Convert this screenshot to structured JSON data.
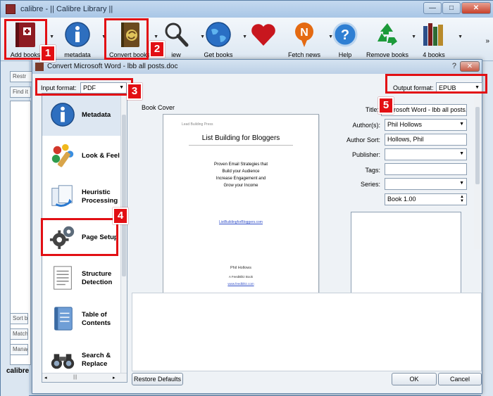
{
  "main_window": {
    "title": "calibre - || Calibre Library ||",
    "window_buttons": {
      "minimize": "—",
      "maximize": "□",
      "close": "✕"
    },
    "toolbar": [
      {
        "label": "Add books",
        "icon": "add-books-icon"
      },
      {
        "label": "metadata",
        "icon": "info-icon"
      },
      {
        "label": "Convert books",
        "icon": "convert-books-icon"
      },
      {
        "label": "iew",
        "icon": "magnifier-icon"
      },
      {
        "label": "Get books",
        "icon": "globe-icon"
      },
      {
        "label": "",
        "icon": "heart-icon"
      },
      {
        "label": "Fetch news",
        "icon": "fetch-news-icon"
      },
      {
        "label": "Help",
        "icon": "help-icon"
      },
      {
        "label": "Remove books",
        "icon": "recycle-icon"
      },
      {
        "label": "4 books",
        "icon": "library-books-icon"
      }
    ],
    "overflow": "»",
    "left_stubs": [
      "Restr",
      "Find it",
      "Sort b",
      "Match",
      "Manag"
    ],
    "footer": "calibre"
  },
  "dialog": {
    "title": "Convert Microsoft Word - lbb all posts.doc",
    "help_glyph": "?",
    "close_glyph": "✕",
    "input_format_label": "Input format:",
    "input_format_value": "PDF",
    "output_format_label": "Output format:",
    "output_format_value": "EPUB",
    "nav": [
      {
        "label": "Metadata",
        "icon": "metadata-info-icon",
        "selected": true
      },
      {
        "label": "Look & Feel",
        "icon": "look-feel-icon",
        "selected": false
      },
      {
        "label": "Heuristic Processing",
        "icon": "heuristic-icon",
        "selected": false
      },
      {
        "label": "Page Setup",
        "icon": "page-setup-gear-icon",
        "selected": false
      },
      {
        "label": "Structure Detection",
        "icon": "structure-doc-icon",
        "selected": false
      },
      {
        "label": "Table of Contents",
        "icon": "toc-book-icon",
        "selected": false
      },
      {
        "label": "Search & Replace",
        "icon": "binoculars-icon",
        "selected": false
      }
    ],
    "nav_hscroll_arrows": {
      "left": "◂",
      "right": "▸",
      "thumb": "|||"
    },
    "book_cover_label": "Book Cover",
    "cover": {
      "header_text": "Lead Building Press",
      "title": "List Building for Bloggers",
      "subtitle_lines": [
        "Proven Email Strategies that",
        "Build your Audience",
        "Increase Engagement and",
        "Grow your Income"
      ],
      "link": "ListBuildingforBloggers.com",
      "author_lines": [
        "Phil Hollows",
        "A FeedBlitz Book",
        "www.feedblitz.com"
      ]
    },
    "metadata": {
      "title_label": "Title:",
      "title_value": "Microsoft Word - lbb all posts.doc",
      "authors_label": "Author(s):",
      "authors_value": "Phil Hollows",
      "author_sort_label": "Author Sort:",
      "author_sort_value": "Hollows, Phil",
      "publisher_label": "Publisher:",
      "publisher_value": "",
      "tags_label": "Tags:",
      "tags_value": "",
      "series_label": "Series:",
      "series_value": "",
      "series_index_value": "Book 1.00"
    },
    "buttons": {
      "restore_defaults": "Restore Defaults",
      "ok": "OK",
      "cancel": "Cancel"
    }
  },
  "annotations": [
    {
      "number": "1",
      "target": "Add books"
    },
    {
      "number": "2",
      "target": "Convert books"
    },
    {
      "number": "3",
      "target": "Input format"
    },
    {
      "number": "4",
      "target": "Page Setup"
    },
    {
      "number": "5",
      "target": "Output format"
    }
  ],
  "colors": {
    "annotation_red": "#e20f14",
    "title_bar": "#bcd0e6",
    "selected_nav": "#dde7f2"
  }
}
